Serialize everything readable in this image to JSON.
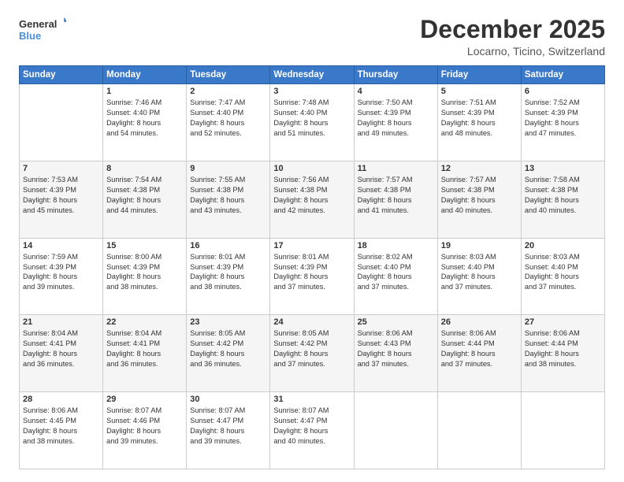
{
  "logo": {
    "line1": "General",
    "line2": "Blue"
  },
  "title": "December 2025",
  "location": "Locarno, Ticino, Switzerland",
  "days_header": [
    "Sunday",
    "Monday",
    "Tuesday",
    "Wednesday",
    "Thursday",
    "Friday",
    "Saturday"
  ],
  "weeks": [
    [
      {
        "day": "",
        "info": ""
      },
      {
        "day": "1",
        "info": "Sunrise: 7:46 AM\nSunset: 4:40 PM\nDaylight: 8 hours\nand 54 minutes."
      },
      {
        "day": "2",
        "info": "Sunrise: 7:47 AM\nSunset: 4:40 PM\nDaylight: 8 hours\nand 52 minutes."
      },
      {
        "day": "3",
        "info": "Sunrise: 7:48 AM\nSunset: 4:40 PM\nDaylight: 8 hours\nand 51 minutes."
      },
      {
        "day": "4",
        "info": "Sunrise: 7:50 AM\nSunset: 4:39 PM\nDaylight: 8 hours\nand 49 minutes."
      },
      {
        "day": "5",
        "info": "Sunrise: 7:51 AM\nSunset: 4:39 PM\nDaylight: 8 hours\nand 48 minutes."
      },
      {
        "day": "6",
        "info": "Sunrise: 7:52 AM\nSunset: 4:39 PM\nDaylight: 8 hours\nand 47 minutes."
      }
    ],
    [
      {
        "day": "7",
        "info": "Sunrise: 7:53 AM\nSunset: 4:39 PM\nDaylight: 8 hours\nand 45 minutes."
      },
      {
        "day": "8",
        "info": "Sunrise: 7:54 AM\nSunset: 4:38 PM\nDaylight: 8 hours\nand 44 minutes."
      },
      {
        "day": "9",
        "info": "Sunrise: 7:55 AM\nSunset: 4:38 PM\nDaylight: 8 hours\nand 43 minutes."
      },
      {
        "day": "10",
        "info": "Sunrise: 7:56 AM\nSunset: 4:38 PM\nDaylight: 8 hours\nand 42 minutes."
      },
      {
        "day": "11",
        "info": "Sunrise: 7:57 AM\nSunset: 4:38 PM\nDaylight: 8 hours\nand 41 minutes."
      },
      {
        "day": "12",
        "info": "Sunrise: 7:57 AM\nSunset: 4:38 PM\nDaylight: 8 hours\nand 40 minutes."
      },
      {
        "day": "13",
        "info": "Sunrise: 7:58 AM\nSunset: 4:38 PM\nDaylight: 8 hours\nand 40 minutes."
      }
    ],
    [
      {
        "day": "14",
        "info": "Sunrise: 7:59 AM\nSunset: 4:39 PM\nDaylight: 8 hours\nand 39 minutes."
      },
      {
        "day": "15",
        "info": "Sunrise: 8:00 AM\nSunset: 4:39 PM\nDaylight: 8 hours\nand 38 minutes."
      },
      {
        "day": "16",
        "info": "Sunrise: 8:01 AM\nSunset: 4:39 PM\nDaylight: 8 hours\nand 38 minutes."
      },
      {
        "day": "17",
        "info": "Sunrise: 8:01 AM\nSunset: 4:39 PM\nDaylight: 8 hours\nand 37 minutes."
      },
      {
        "day": "18",
        "info": "Sunrise: 8:02 AM\nSunset: 4:40 PM\nDaylight: 8 hours\nand 37 minutes."
      },
      {
        "day": "19",
        "info": "Sunrise: 8:03 AM\nSunset: 4:40 PM\nDaylight: 8 hours\nand 37 minutes."
      },
      {
        "day": "20",
        "info": "Sunrise: 8:03 AM\nSunset: 4:40 PM\nDaylight: 8 hours\nand 37 minutes."
      }
    ],
    [
      {
        "day": "21",
        "info": "Sunrise: 8:04 AM\nSunset: 4:41 PM\nDaylight: 8 hours\nand 36 minutes."
      },
      {
        "day": "22",
        "info": "Sunrise: 8:04 AM\nSunset: 4:41 PM\nDaylight: 8 hours\nand 36 minutes."
      },
      {
        "day": "23",
        "info": "Sunrise: 8:05 AM\nSunset: 4:42 PM\nDaylight: 8 hours\nand 36 minutes."
      },
      {
        "day": "24",
        "info": "Sunrise: 8:05 AM\nSunset: 4:42 PM\nDaylight: 8 hours\nand 37 minutes."
      },
      {
        "day": "25",
        "info": "Sunrise: 8:06 AM\nSunset: 4:43 PM\nDaylight: 8 hours\nand 37 minutes."
      },
      {
        "day": "26",
        "info": "Sunrise: 8:06 AM\nSunset: 4:44 PM\nDaylight: 8 hours\nand 37 minutes."
      },
      {
        "day": "27",
        "info": "Sunrise: 8:06 AM\nSunset: 4:44 PM\nDaylight: 8 hours\nand 38 minutes."
      }
    ],
    [
      {
        "day": "28",
        "info": "Sunrise: 8:06 AM\nSunset: 4:45 PM\nDaylight: 8 hours\nand 38 minutes."
      },
      {
        "day": "29",
        "info": "Sunrise: 8:07 AM\nSunset: 4:46 PM\nDaylight: 8 hours\nand 39 minutes."
      },
      {
        "day": "30",
        "info": "Sunrise: 8:07 AM\nSunset: 4:47 PM\nDaylight: 8 hours\nand 39 minutes."
      },
      {
        "day": "31",
        "info": "Sunrise: 8:07 AM\nSunset: 4:47 PM\nDaylight: 8 hours\nand 40 minutes."
      },
      {
        "day": "",
        "info": ""
      },
      {
        "day": "",
        "info": ""
      },
      {
        "day": "",
        "info": ""
      }
    ]
  ]
}
